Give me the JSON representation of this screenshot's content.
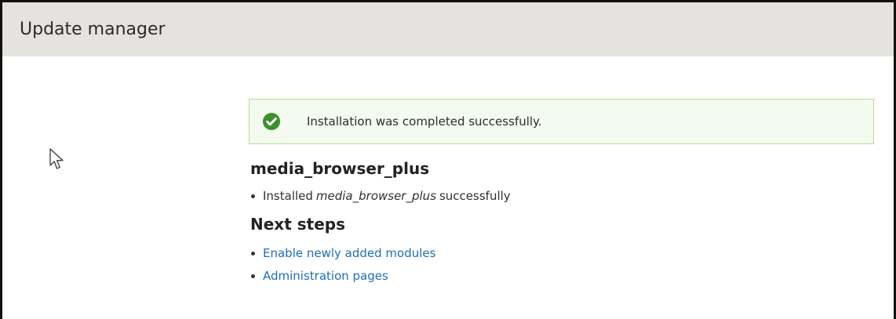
{
  "header": {
    "title": "Update manager"
  },
  "status": {
    "message": "Installation was completed successfully.",
    "icon": "check-circle-icon",
    "color": "#3f8f2e"
  },
  "module": {
    "name": "media_browser_plus",
    "result_prefix": "Installed",
    "result_module": "media_browser_plus",
    "result_suffix": "successfully"
  },
  "next_steps": {
    "title": "Next steps",
    "links": [
      {
        "label": "Enable newly added modules"
      },
      {
        "label": "Administration pages"
      }
    ]
  },
  "cursor": {
    "icon": "mouse-pointer-icon"
  }
}
